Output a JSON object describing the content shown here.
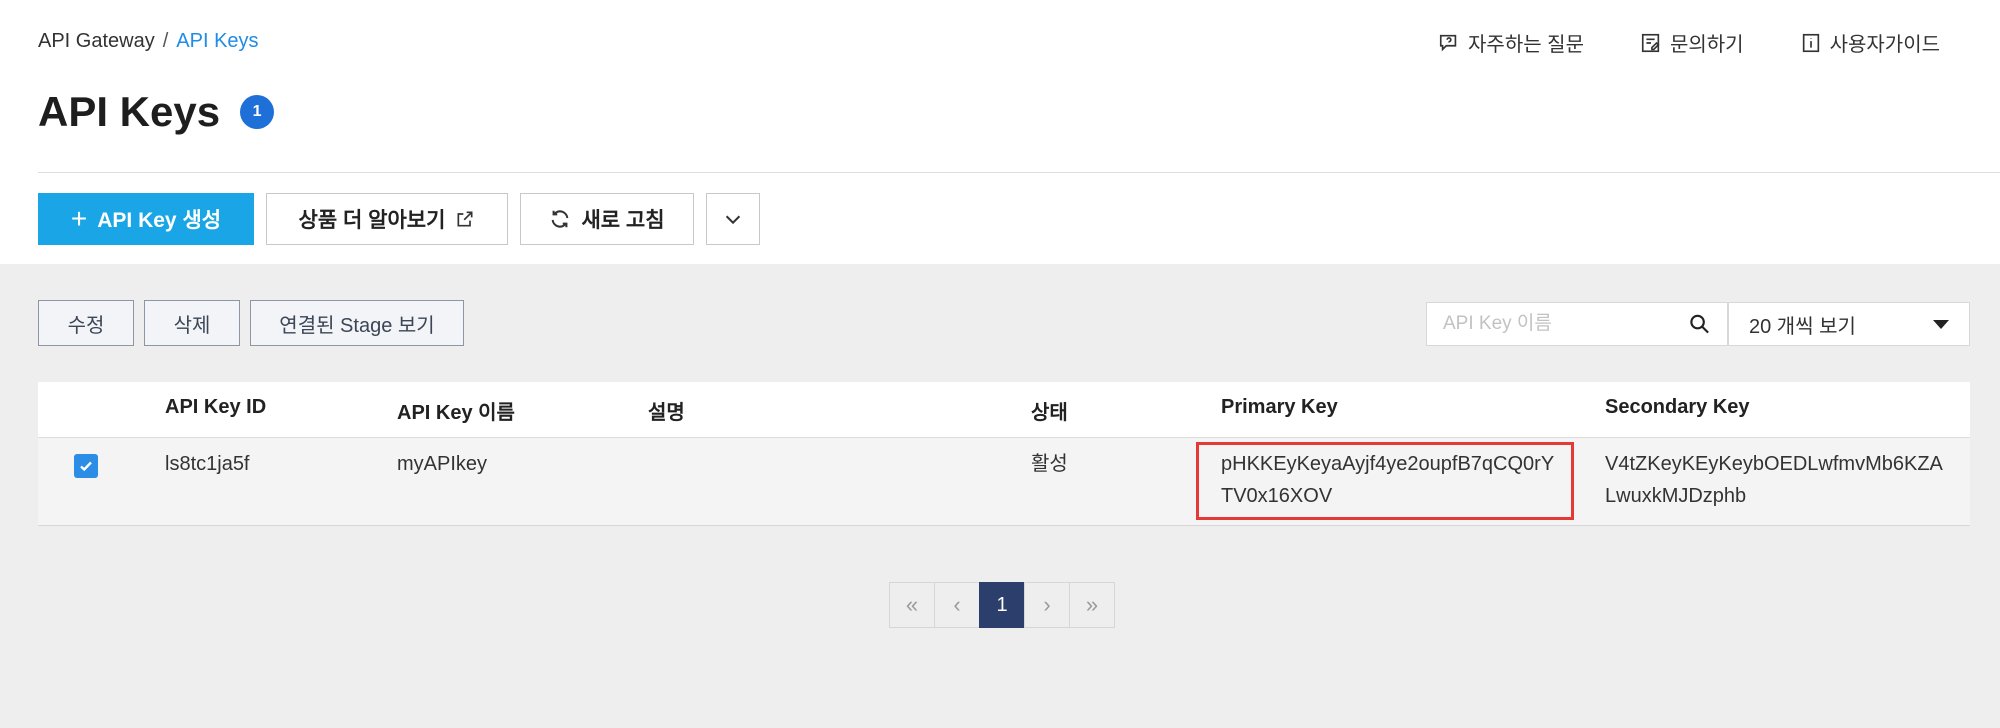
{
  "breadcrumb": {
    "parent": "API Gateway",
    "separator": "/",
    "current": "API Keys"
  },
  "help_links": {
    "faq": {
      "label": "자주하는 질문",
      "icon": "chat-question-icon"
    },
    "inquiry": {
      "label": "문의하기",
      "icon": "edit-note-icon"
    },
    "guide": {
      "label": "사용자가이드",
      "icon": "document-info-icon"
    }
  },
  "page": {
    "title": "API Keys",
    "count_badge": "1"
  },
  "toolbar": {
    "create_label": "API Key 생성",
    "create_icon": "plus-icon",
    "learn_more_label": "상품 더 알아보기",
    "learn_more_icon": "external-link-icon",
    "refresh_label": "새로 고침",
    "refresh_icon": "refresh-icon",
    "more_icon": "chevron-down-icon"
  },
  "actions": {
    "edit": "수정",
    "delete": "삭제",
    "view_stages": "연결된 Stage 보기"
  },
  "search": {
    "placeholder": "API Key 이름",
    "value": "",
    "icon": "search-icon"
  },
  "page_size": {
    "selected": "20 개씩 보기"
  },
  "table": {
    "columns": [
      "API Key ID",
      "API Key 이름",
      "설명",
      "상태",
      "Primary Key",
      "Secondary Key"
    ],
    "rows": [
      {
        "checked": true,
        "id": "ls8tc1ja5f",
        "name": "myAPIkey",
        "description": "",
        "status": "활성",
        "primary_key": "pHKKEyKeyaAyjf4ye2oupfB7qCQ0rYTV0x16XOV",
        "secondary_key": "V4tZKeyKEyKeybOEDLwfmvMb6KZALwuxkMJDzphb"
      }
    ]
  },
  "pagination": {
    "first": "«",
    "prev": "‹",
    "current": "1",
    "next": "›",
    "last": "»"
  },
  "colors": {
    "accent": "#1aa6e6",
    "badge": "#1f6fd8",
    "pagination_active": "#2c3e6b",
    "highlight": "#e53935"
  }
}
